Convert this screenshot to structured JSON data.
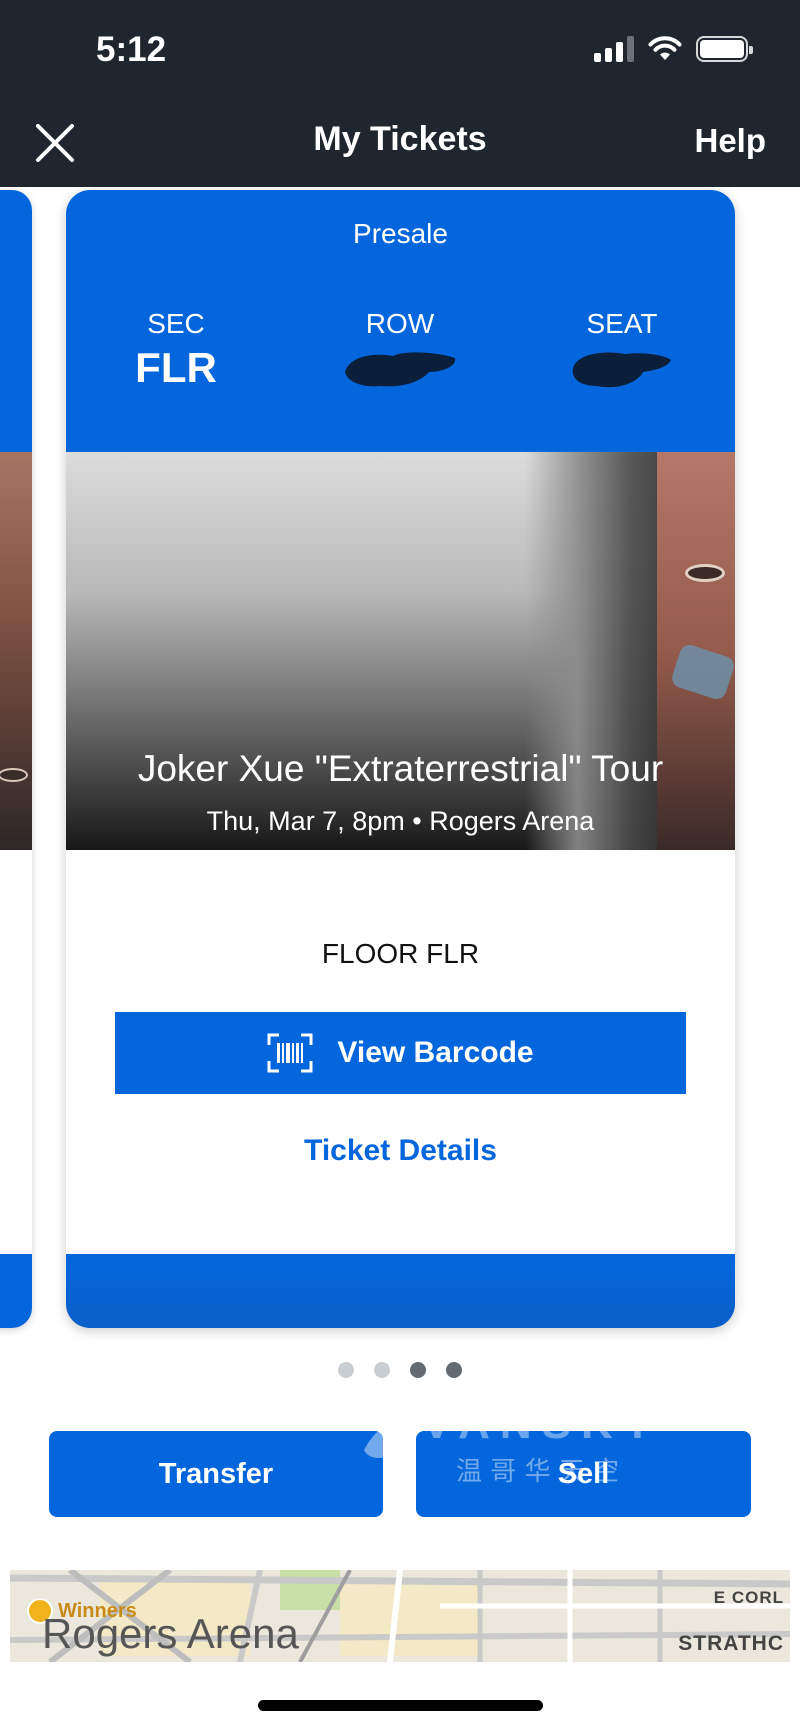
{
  "status_bar": {
    "time": "5:12"
  },
  "header": {
    "title": "My Tickets",
    "help_label": "Help",
    "close_icon": "close-icon"
  },
  "ticket": {
    "presale_label": "Presale",
    "section_label": "SEC",
    "section_value": "FLR",
    "row_label": "ROW",
    "seat_label": "SEAT",
    "event_title": "Joker Xue \"Extraterrestrial\" Tour",
    "event_datetime": "Thu, Mar 7, 8pm",
    "event_venue": "Rogers Arena",
    "separator": "•",
    "floor_label": "FLOOR FLR",
    "barcode_button": "View Barcode",
    "barcode_icon": "barcode-icon",
    "details_link": "Ticket Details"
  },
  "pager": {
    "total": 4,
    "active_index": 3
  },
  "actions": {
    "transfer_label": "Transfer",
    "sell_label": "Sell"
  },
  "watermark": {
    "text": "VANSKY",
    "subtext": "温 哥 华 天 空"
  },
  "map": {
    "venue_label": "Rogers Arena",
    "store_label": "Winners",
    "street_1": "E CORL",
    "street_2": "STRATHC"
  },
  "colors": {
    "brand_blue": "#0366dd",
    "header_bg": "#1f262d"
  }
}
